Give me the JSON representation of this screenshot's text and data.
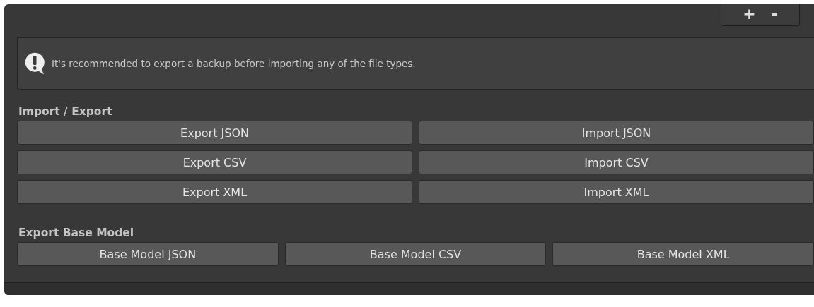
{
  "toolbar": {
    "buttons": [
      "+",
      "-"
    ]
  },
  "help_box": {
    "message": "It's recommended to export a backup before importing any of the file types."
  },
  "sections": [
    {
      "title": "Import / Export",
      "buttons": [
        "Export JSON",
        "Import JSON",
        "Export CSV",
        "Import CSV",
        "Export XML",
        "Import XML"
      ]
    },
    {
      "title": "Export Base Model",
      "buttons": [
        "Base Model JSON",
        "Base Model CSV",
        "Base Model XML"
      ]
    }
  ]
}
